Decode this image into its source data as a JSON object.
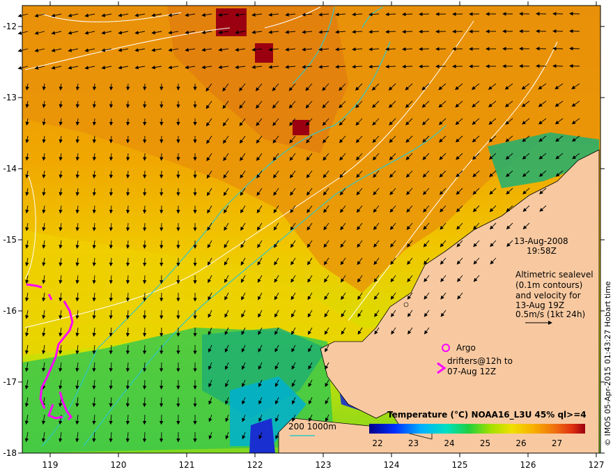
{
  "map": {
    "x_ticks": [
      "119",
      "120",
      "121",
      "122",
      "123",
      "124",
      "125",
      "126",
      "127"
    ],
    "y_ticks": [
      "-12",
      "-13",
      "-14",
      "-15",
      "-16",
      "-17",
      "-18"
    ],
    "date": "13-Aug-2008",
    "time": "19:58Z",
    "altimetry_note": [
      "Altimetric sealevel",
      "(0.1m contours)",
      "and velocity for",
      "13-Aug 19Z",
      "0.5m/s (1kt 24h)"
    ],
    "argo_label": "Argo",
    "drifters_label_1": "drifters@12h to",
    "drifters_label_2": "07-Aug 12Z",
    "bathymetry_label": "200  1000m",
    "colorbar_title": "Temperature (°C) NOAA16_L3U 45% ql>=4",
    "colorbar_ticks": [
      "22",
      "23",
      "24",
      "25",
      "26",
      "27"
    ],
    "credit": "© IMOS 05-Apr-2015 01:43:27 Hobart time",
    "colors": {
      "land": "#f8c9a0",
      "orange": "#e8900a",
      "yellow": "#f0d000",
      "green": "#3cc84a",
      "cyan": "#00c8d0",
      "blue": "#1a2fd0",
      "darkred": "#9a0010",
      "magenta": "#ff00ff"
    }
  }
}
